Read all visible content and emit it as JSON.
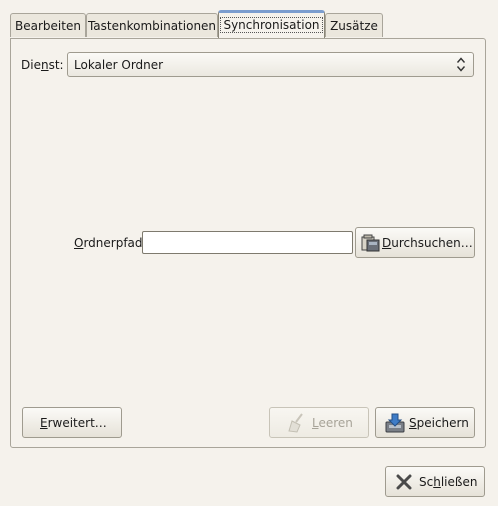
{
  "tabs": [
    {
      "label": "Bearbeiten"
    },
    {
      "label": "Tastenkombinationen"
    },
    {
      "label": "Synchronisation"
    },
    {
      "label": "Zusätze"
    }
  ],
  "service": {
    "label_pre": "Die",
    "label_accel": "n",
    "label_post": "st:",
    "value": "Lokaler Ordner"
  },
  "folder": {
    "label_accel": "O",
    "label_post": "rdnerpfad:",
    "value": "",
    "browse_accel": "D",
    "browse_post": "urchsuchen…"
  },
  "buttons": {
    "advanced_accel": "E",
    "advanced_post": "rweitert…",
    "clear_accel": "L",
    "clear_post": "eeren",
    "save_accel": "S",
    "save_post": "peichern",
    "close_pre": "Sc",
    "close_accel": "h",
    "close_post": "ließen"
  }
}
